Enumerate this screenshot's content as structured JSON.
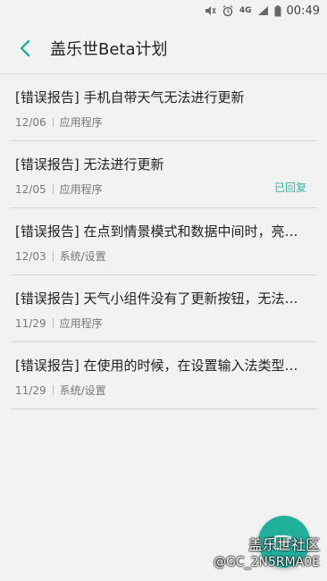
{
  "status_bar": {
    "network": "4G",
    "time": "00:49",
    "icons": [
      "mute-icon",
      "alarm-icon",
      "network-4g-icon",
      "signal-icon",
      "battery-icon"
    ]
  },
  "header": {
    "title": "盖乐世Beta计划",
    "back_icon": "chevron-left-icon"
  },
  "colors": {
    "accent": "#21b09b",
    "reply_status": "#35b7a5"
  },
  "reports": [
    {
      "title": "[错误报告] 手机自带天气无法进行更新",
      "date": "12/06",
      "category": "应用程序",
      "status": ""
    },
    {
      "title": "[错误报告] 无法进行更新",
      "date": "12/05",
      "category": "应用程序",
      "status": "已回复"
    },
    {
      "title": "[错误报告] 在点到情景模式和数据中间时，亮…",
      "date": "12/03",
      "category": "系统/设置",
      "status": ""
    },
    {
      "title": "[错误报告] 天气小组件没有了更新按钮，无法…",
      "date": "11/29",
      "category": "应用程序",
      "status": ""
    },
    {
      "title": "[错误报告] 在使用的时候，在设置输入法类型…",
      "date": "11/29",
      "category": "系统/设置",
      "status": ""
    }
  ],
  "fab": {
    "icon": "compose-icon"
  },
  "watermark": {
    "line1": "盖乐世社区",
    "line2": "@GC_2N5RMA0E"
  }
}
